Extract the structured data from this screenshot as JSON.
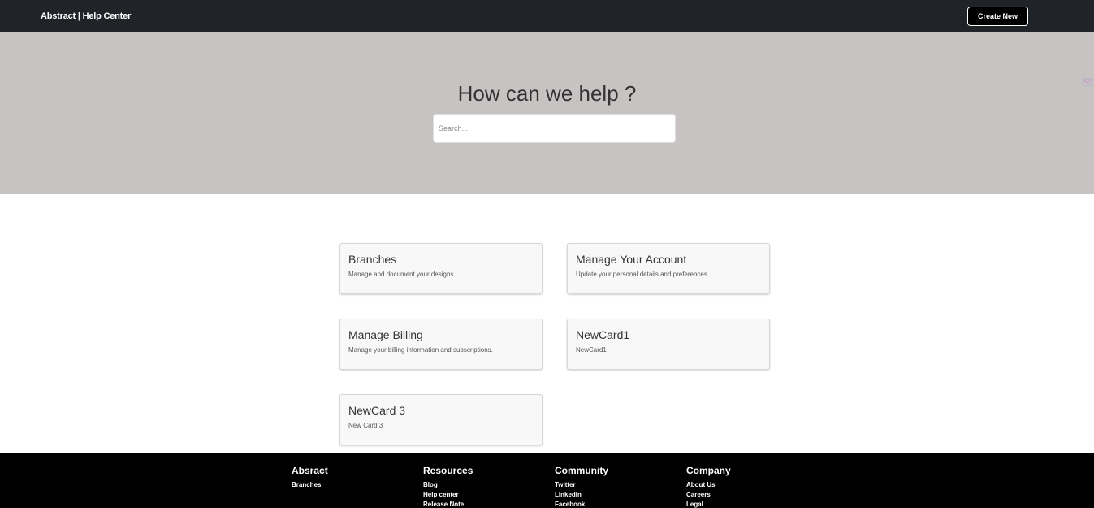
{
  "header": {
    "brand": "Abstract | Help Center",
    "create_button": "Create New"
  },
  "hero": {
    "title": "How can we help ?",
    "search_placeholder": "Search..."
  },
  "cards": [
    {
      "title": "Branches",
      "description": "Manage and document your designs."
    },
    {
      "title": "Manage Your Account",
      "description": "Update your personal details and preferences."
    },
    {
      "title": "Manage Billing",
      "description": "Manage your billing information and subscriptions."
    },
    {
      "title": "NewCard1",
      "description": "NewCard1"
    },
    {
      "title": "NewCard 3",
      "description": "New Card 3"
    }
  ],
  "footer": {
    "columns": [
      {
        "heading": "Absract",
        "links": [
          "Branches"
        ]
      },
      {
        "heading": "Resources",
        "links": [
          "Blog",
          "Help center",
          "Release Note"
        ]
      },
      {
        "heading": "Community",
        "links": [
          "Twitter",
          "LinkedIn",
          "Facebook"
        ]
      },
      {
        "heading": "Company",
        "links": [
          "About Us",
          "Careers",
          "Legal"
        ]
      }
    ]
  },
  "colors": {
    "topbar": "#202328",
    "hero": "#c8c3c3",
    "footer": "#000000"
  }
}
